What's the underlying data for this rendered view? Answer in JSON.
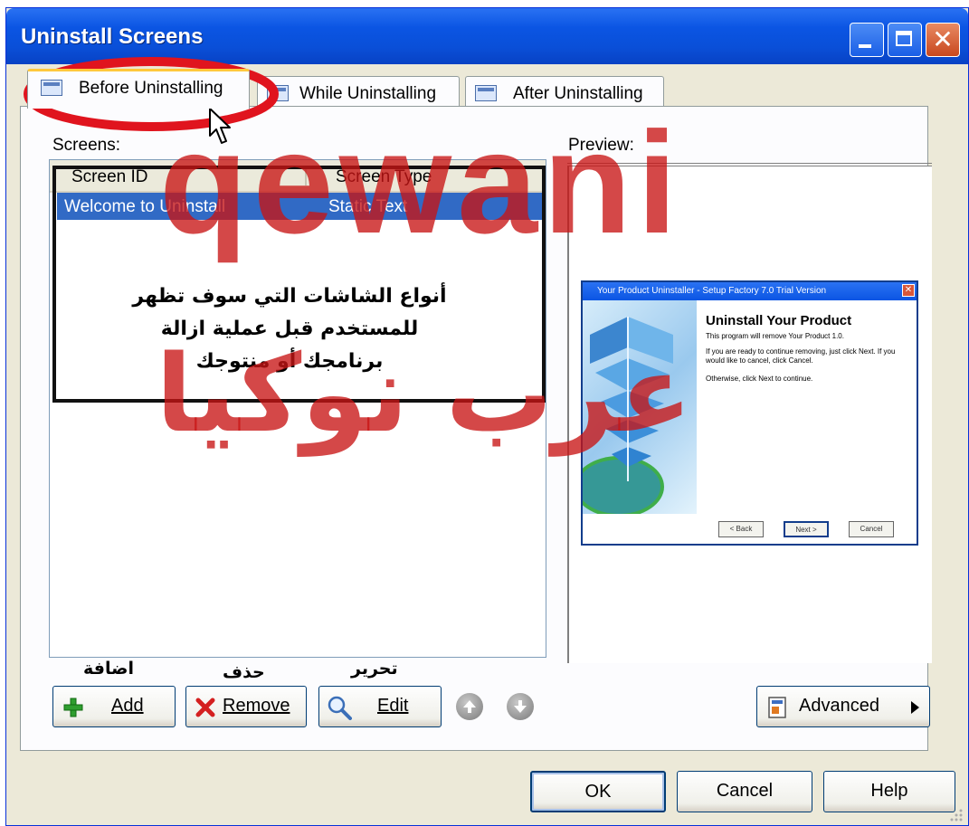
{
  "window": {
    "title": "Uninstall Screens"
  },
  "tabs": [
    {
      "label": "Before Uninstalling",
      "active": true
    },
    {
      "label": "While Uninstalling",
      "active": false
    },
    {
      "label": "After Uninstalling",
      "active": false
    }
  ],
  "screens": {
    "label": "Screens:",
    "columns": [
      "Screen ID",
      "Screen Type"
    ],
    "rows": [
      {
        "screen_id": "Welcome to Uninstall",
        "screen_type": "Static Text",
        "selected": true
      }
    ]
  },
  "preview": {
    "label": "Preview:",
    "mini_window": {
      "title": "Your Product Uninstaller - Setup Factory 7.0 Trial Version",
      "heading": "Uninstall Your Product",
      "subtitle": "This program will remove Your Product 1.0.",
      "body": "If you are ready to continue removing, just click Next. If you would like to cancel, click Cancel.",
      "instruction": "Otherwise, click Next to continue.",
      "buttons": [
        "< Back",
        "Next >",
        "Cancel"
      ]
    }
  },
  "annotation": {
    "arabic_lines": [
      "أنواع الشاشات التي سوف تظهر",
      "للمستخدم قبل عملية ازالة",
      "برنامجك أو منتوجك"
    ],
    "add_caption": "اضافة",
    "remove_caption": "حذف",
    "edit_caption": "تحرير"
  },
  "buttons": {
    "add": "Add",
    "remove": "Remove",
    "edit": "Edit",
    "advanced": "Advanced",
    "ok": "OK",
    "cancel": "Cancel",
    "help": "Help"
  },
  "watermark": {
    "latin": "qewani",
    "arabic": "عرب نوكيا"
  },
  "colors": {
    "titlebar": "#0b55e3",
    "selection": "#316ac5",
    "watermark": "#c81414",
    "highlight_ellipse": "#e0141e"
  }
}
